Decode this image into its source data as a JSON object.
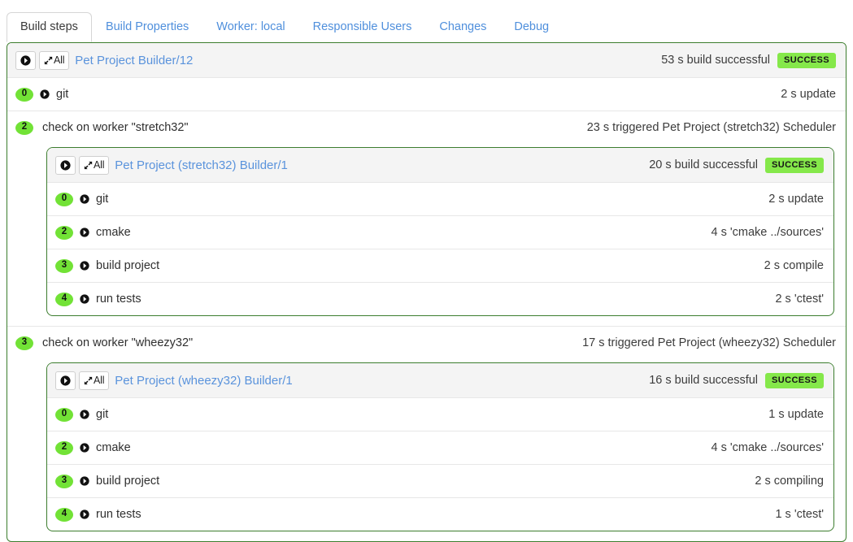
{
  "tabs": [
    {
      "label": "Build steps",
      "active": true
    },
    {
      "label": "Build Properties",
      "active": false
    },
    {
      "label": "Worker: local",
      "active": false
    },
    {
      "label": "Responsible Users",
      "active": false
    },
    {
      "label": "Changes",
      "active": false
    },
    {
      "label": "Debug",
      "active": false
    }
  ],
  "colors": {
    "border_green": "#3c7d2e",
    "badge_green": "#85e84a",
    "pill_green": "#72e236",
    "link_blue": "#5a93dc",
    "header_bg": "#f4f4f4"
  },
  "buttons": {
    "go_icon": "circle-arrow-right-icon",
    "expand_icon": "expand-arrows-icon",
    "expand_all_label": "All"
  },
  "build": {
    "title": "Pet Project Builder/12",
    "duration": "53 s",
    "result_text": "build successful",
    "status": "SUCCESS",
    "steps": [
      {
        "number": "0",
        "name": "git",
        "has_arrow": true,
        "duration": "2 s",
        "detail": "update"
      },
      {
        "number": "2",
        "name": "check on worker \"stretch32\"",
        "has_arrow": false,
        "duration": "23 s",
        "detail": "triggered Pet Project (stretch32) Scheduler",
        "nested": {
          "title": "Pet Project (stretch32) Builder/1",
          "duration": "20 s",
          "result_text": "build successful",
          "status": "SUCCESS",
          "steps": [
            {
              "number": "0",
              "name": "git",
              "has_arrow": true,
              "duration": "2 s",
              "detail": "update"
            },
            {
              "number": "2",
              "name": "cmake",
              "has_arrow": true,
              "duration": "4 s",
              "detail": "'cmake ../sources'"
            },
            {
              "number": "3",
              "name": "build project",
              "has_arrow": true,
              "duration": "2 s",
              "detail": "compile"
            },
            {
              "number": "4",
              "name": "run tests",
              "has_arrow": true,
              "duration": "2 s",
              "detail": "'ctest'"
            }
          ]
        }
      },
      {
        "number": "3",
        "name": "check on worker \"wheezy32\"",
        "has_arrow": false,
        "duration": "17 s",
        "detail": "triggered Pet Project (wheezy32) Scheduler",
        "nested": {
          "title": "Pet Project (wheezy32) Builder/1",
          "duration": "16 s",
          "result_text": "build successful",
          "status": "SUCCESS",
          "steps": [
            {
              "number": "0",
              "name": "git",
              "has_arrow": true,
              "duration": "1 s",
              "detail": "update"
            },
            {
              "number": "2",
              "name": "cmake",
              "has_arrow": true,
              "duration": "4 s",
              "detail": "'cmake ../sources'"
            },
            {
              "number": "3",
              "name": "build project",
              "has_arrow": true,
              "duration": "2 s",
              "detail": "compiling"
            },
            {
              "number": "4",
              "name": "run tests",
              "has_arrow": true,
              "duration": "1 s",
              "detail": "'ctest'"
            }
          ]
        }
      }
    ]
  }
}
